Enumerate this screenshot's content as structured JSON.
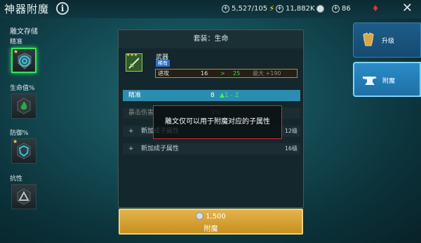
{
  "header": {
    "title": "神器附魔",
    "info_icon": "i",
    "stamina": "5,527/105",
    "silver": "11,882K",
    "gems": "86",
    "close_icon": "✕"
  },
  "sidebar": {
    "title": "雕文存储",
    "groups": [
      {
        "label": "精准",
        "icon": "target-icon"
      },
      {
        "label": "生命值%",
        "icon": "flame-icon"
      },
      {
        "label": "防御%",
        "icon": "shield-icon"
      },
      {
        "label": "抗性",
        "icon": "triangle-icon"
      }
    ],
    "star": "★"
  },
  "panel": {
    "set_title": "套装：生命",
    "item_stars": "★★★",
    "item_name": "武器",
    "item_tag": "稀有",
    "attack": {
      "label": "进攻",
      "current": "16",
      "arrow": ">",
      "next": "25",
      "max": "最大 +190"
    },
    "stats": [
      {
        "name": "精准",
        "value": "8",
        "bonus": "▲1 - 2"
      },
      {
        "name": "暴击伤害",
        "value": "3%"
      }
    ],
    "add_rows": [
      {
        "plus": "+",
        "label": "新加成子属性",
        "level": "12级"
      },
      {
        "plus": "+",
        "label": "新加成子属性",
        "level": "16级"
      }
    ]
  },
  "tooltip": "雕文仅可以用于附魔对应的子属性",
  "enchant": {
    "cost": "1,500",
    "label": "附魔"
  },
  "tabs": {
    "upgrade": "升级",
    "enchant": "附魔"
  },
  "colors": {
    "accent_green": "#35e35a",
    "tooltip_border": "#d8282d",
    "button_gold": "#d8a437",
    "tab_blue": "#2a8cc9"
  }
}
